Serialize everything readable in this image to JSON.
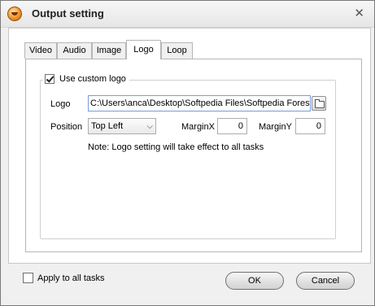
{
  "window": {
    "title": "Output setting",
    "close_glyph": "✕"
  },
  "tabs": [
    {
      "label": "Video"
    },
    {
      "label": "Audio"
    },
    {
      "label": "Image"
    },
    {
      "label": "Logo",
      "active": true
    },
    {
      "label": "Loop"
    }
  ],
  "logo_panel": {
    "use_custom_logo": {
      "label": "Use custom logo",
      "checked": true
    },
    "logo_label": "Logo",
    "logo_path": "C:\\Users\\anca\\Desktop\\Softpedia Files\\Softpedia Forest.",
    "position_label": "Position",
    "position_value": "Top Left",
    "margin_x_label": "MarginX",
    "margin_x_value": "0",
    "margin_y_label": "MarginY",
    "margin_y_value": "0",
    "note": "Note: Logo setting will take effect to all tasks"
  },
  "footer": {
    "apply_all": {
      "label": "Apply to all tasks",
      "checked": false
    },
    "ok_label": "OK",
    "cancel_label": "Cancel"
  },
  "icons": {
    "app": "app-logo-icon",
    "browse": "folder-icon",
    "dropdown": "chevron-down-icon",
    "close": "close-icon"
  }
}
